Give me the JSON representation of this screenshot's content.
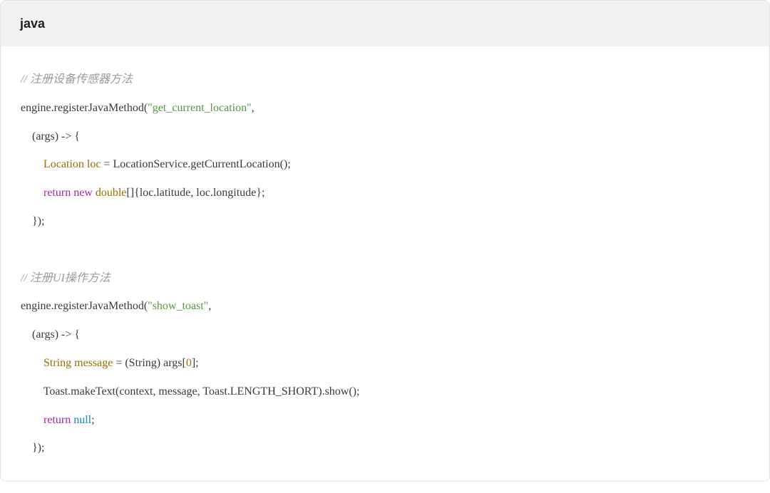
{
  "header": {
    "language": "java"
  },
  "code_lines": [
    [
      {
        "t": "comment",
        "v": "// 注册设备传感器方法"
      }
    ],
    [
      {
        "t": "plain",
        "v": "engine.registerJavaMethod("
      },
      {
        "t": "string",
        "v": "\"get_current_location\""
      },
      {
        "t": "plain",
        "v": ","
      }
    ],
    [
      {
        "t": "plain",
        "v": "    (args) -> {"
      }
    ],
    [
      {
        "t": "plain",
        "v": "        "
      },
      {
        "t": "type",
        "v": "Location"
      },
      {
        "t": "plain",
        "v": " "
      },
      {
        "t": "type",
        "v": "loc"
      },
      {
        "t": "plain",
        "v": " = LocationService.getCurrentLocation();"
      }
    ],
    [
      {
        "t": "plain",
        "v": "        "
      },
      {
        "t": "keyword",
        "v": "return"
      },
      {
        "t": "plain",
        "v": " "
      },
      {
        "t": "keyword",
        "v": "new"
      },
      {
        "t": "plain",
        "v": " "
      },
      {
        "t": "type",
        "v": "double"
      },
      {
        "t": "plain",
        "v": "[]{loc.latitude, loc.longitude};"
      }
    ],
    [
      {
        "t": "plain",
        "v": "    });"
      }
    ],
    [],
    [
      {
        "t": "comment",
        "v": "// 注册UI操作方法"
      }
    ],
    [
      {
        "t": "plain",
        "v": "engine.registerJavaMethod("
      },
      {
        "t": "string",
        "v": "\"show_toast\""
      },
      {
        "t": "plain",
        "v": ","
      }
    ],
    [
      {
        "t": "plain",
        "v": "    (args) -> {"
      }
    ],
    [
      {
        "t": "plain",
        "v": "        "
      },
      {
        "t": "type",
        "v": "String"
      },
      {
        "t": "plain",
        "v": " "
      },
      {
        "t": "type",
        "v": "message"
      },
      {
        "t": "plain",
        "v": " = (String) args["
      },
      {
        "t": "number",
        "v": "0"
      },
      {
        "t": "plain",
        "v": "];"
      }
    ],
    [
      {
        "t": "plain",
        "v": "        Toast.makeText(context, message, Toast.LENGTH_SHORT).show();"
      }
    ],
    [
      {
        "t": "plain",
        "v": "        "
      },
      {
        "t": "keyword",
        "v": "return"
      },
      {
        "t": "plain",
        "v": " "
      },
      {
        "t": "literal",
        "v": "null"
      },
      {
        "t": "plain",
        "v": ";"
      }
    ],
    [
      {
        "t": "plain",
        "v": "    });"
      }
    ]
  ],
  "colors": {
    "comment": "#9b9b9b",
    "string": "#4f9a3f",
    "type": "#9a6d00",
    "keyword": "#a626a4",
    "literal": "#1b7fc2",
    "plain": "#3a3a3a",
    "header_bg": "#f1f1f1"
  }
}
